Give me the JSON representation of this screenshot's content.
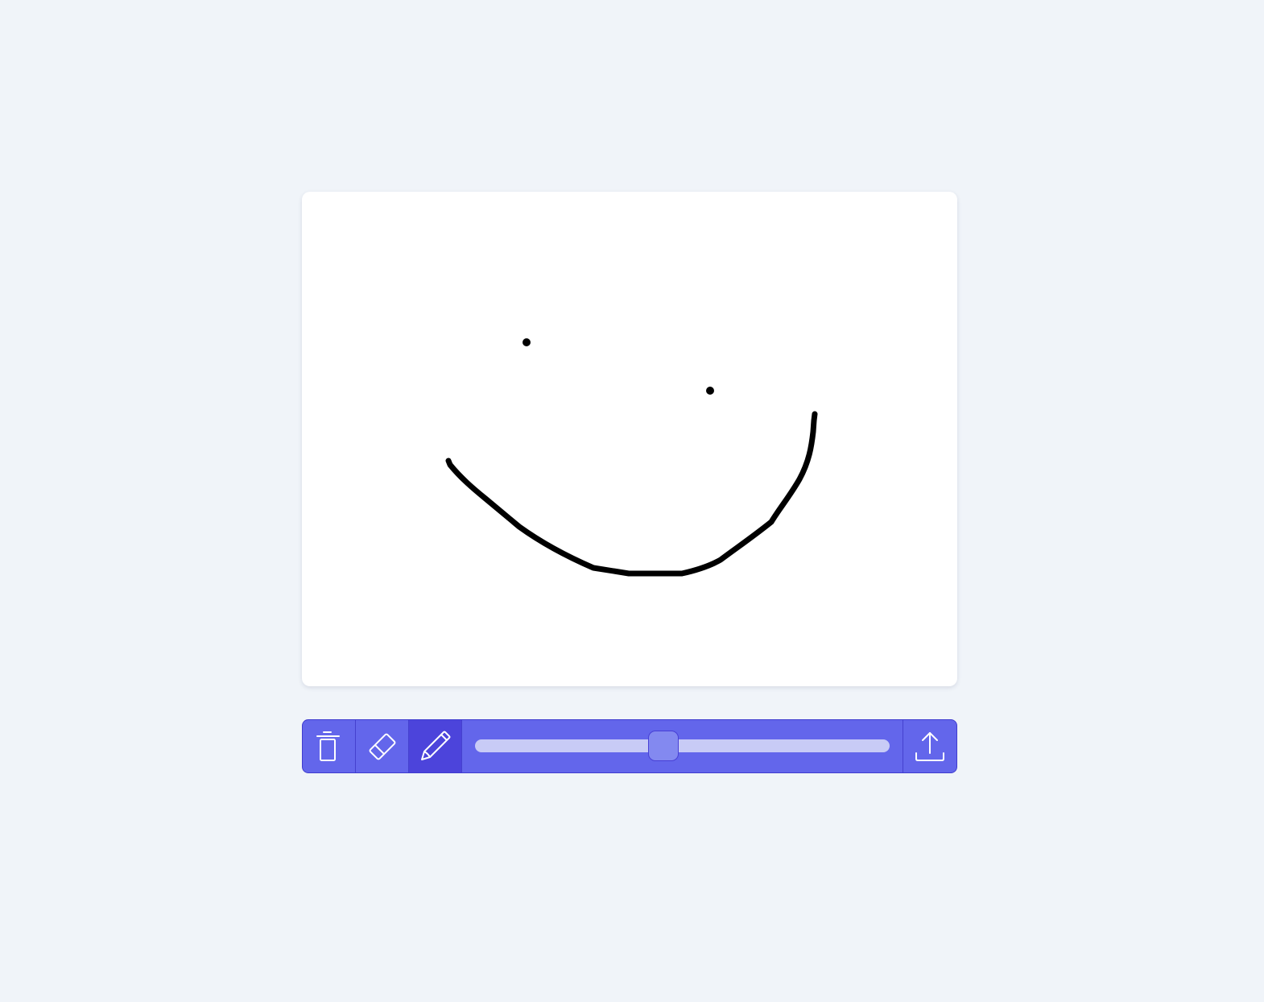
{
  "app": {
    "background_color": "#f0f4f9",
    "canvas_color": "#ffffff",
    "ink_color": "#000000"
  },
  "toolbar": {
    "accent_color": "#6366eb",
    "active_color": "#4c44db",
    "tools": [
      {
        "name": "clear",
        "icon": "trash-icon",
        "active": false
      },
      {
        "name": "eraser",
        "icon": "eraser-icon",
        "active": false
      },
      {
        "name": "pen",
        "icon": "pencil-icon",
        "active": true
      }
    ],
    "brush_size_slider": {
      "value_fraction": 0.45
    },
    "export": {
      "icon": "upload-icon"
    }
  }
}
